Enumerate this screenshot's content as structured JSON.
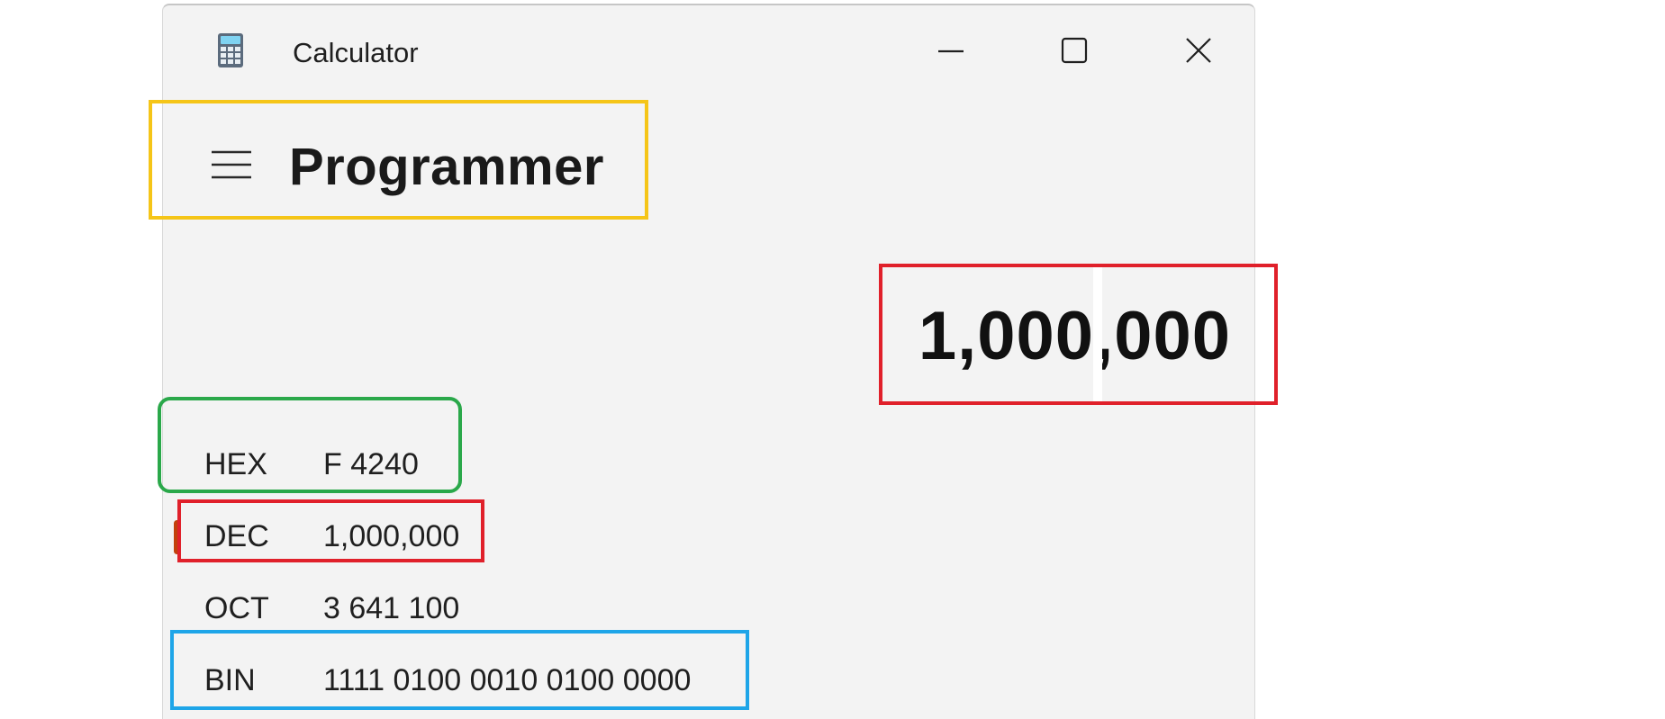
{
  "window": {
    "title": "Calculator",
    "icon": "calculator-icon"
  },
  "caption_buttons": {
    "minimize": "minimize-icon",
    "maximize": "maximize-icon",
    "close": "close-icon"
  },
  "header": {
    "menu_icon": "hamburger-menu-icon",
    "mode": "Programmer"
  },
  "display": {
    "result": "1,000,000"
  },
  "radix": [
    {
      "label": "HEX",
      "value": "F 4240",
      "selected": false
    },
    {
      "label": "DEC",
      "value": "1,000,000",
      "selected": true
    },
    {
      "label": "OCT",
      "value": "3 641 100",
      "selected": false
    },
    {
      "label": "BIN",
      "value": "1111 0100 0010 0100 0000",
      "selected": false
    }
  ],
  "colors": {
    "window_bg": "#f3f3f3",
    "selected_indicator": "#c2410c",
    "annotation_yellow": "#f5c518",
    "annotation_red": "#e0202a",
    "annotation_green": "#2aa84a",
    "annotation_blue": "#1ea5e8"
  }
}
